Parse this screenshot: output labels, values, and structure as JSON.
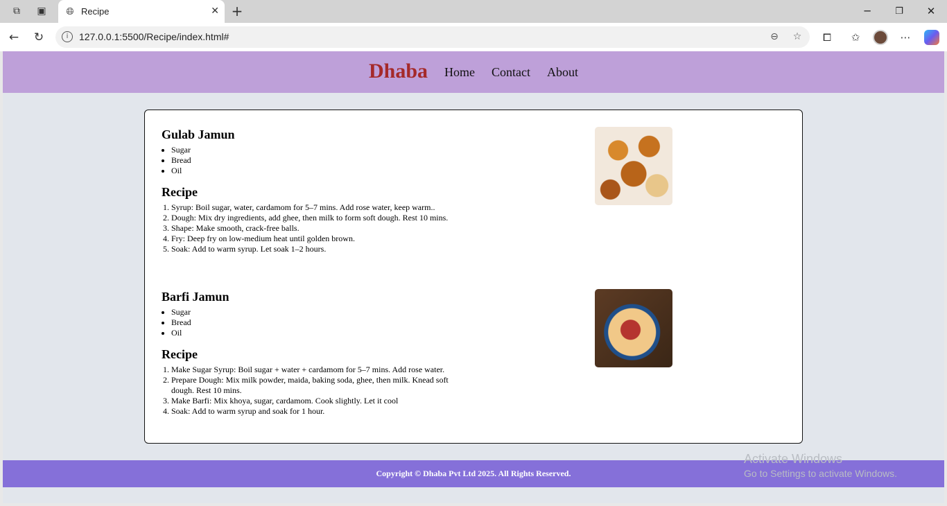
{
  "browser": {
    "tab_title": "Recipe",
    "tab_close": "✕",
    "new_tab": "+",
    "url": "127.0.0.1:5500/Recipe/index.html#",
    "info_glyph": "i"
  },
  "site": {
    "brand": "Dhaba",
    "nav": [
      "Home",
      "Contact",
      "About"
    ]
  },
  "recipes": [
    {
      "title": "Gulab Jamun",
      "ingredients": [
        "Sugar",
        "Bread",
        "Oil"
      ],
      "recipe_heading": "Recipe",
      "steps": [
        "Syrup: Boil sugar, water, cardamom for 5–7 mins. Add rose water, keep warm..",
        "Dough: Mix dry ingredients, add ghee, then milk to form soft dough. Rest 10 mins.",
        "Shape: Make smooth, crack-free balls.",
        "Fry: Deep fry on low-medium heat until golden brown.",
        "Soak: Add to warm syrup. Let soak 1–2 hours."
      ]
    },
    {
      "title": "Barfi Jamun",
      "ingredients": [
        "Sugar",
        "Bread",
        "Oil"
      ],
      "recipe_heading": "Recipe",
      "steps": [
        "Make Sugar Syrup: Boil sugar + water + cardamom for 5–7 mins. Add rose water.",
        "Prepare Dough: Mix milk powder, maida, baking soda, ghee, then milk. Knead soft dough. Rest 10 mins.",
        "Make Barfi: Mix khoya, sugar, cardamom. Cook slightly. Let it cool",
        "Soak: Add to warm syrup and soak for 1 hour."
      ]
    }
  ],
  "footer": {
    "text": "Copyright © Dhaba Pvt Ltd 2025. All Rights Reserved."
  },
  "watermark": {
    "line1": "Activate Windows",
    "line2": "Go to Settings to activate Windows."
  },
  "colors": {
    "header_bg": "#bea0d9",
    "brand": "#a52a2a",
    "footer_bg": "#8570d9",
    "page_bg": "#e2e6ec"
  }
}
